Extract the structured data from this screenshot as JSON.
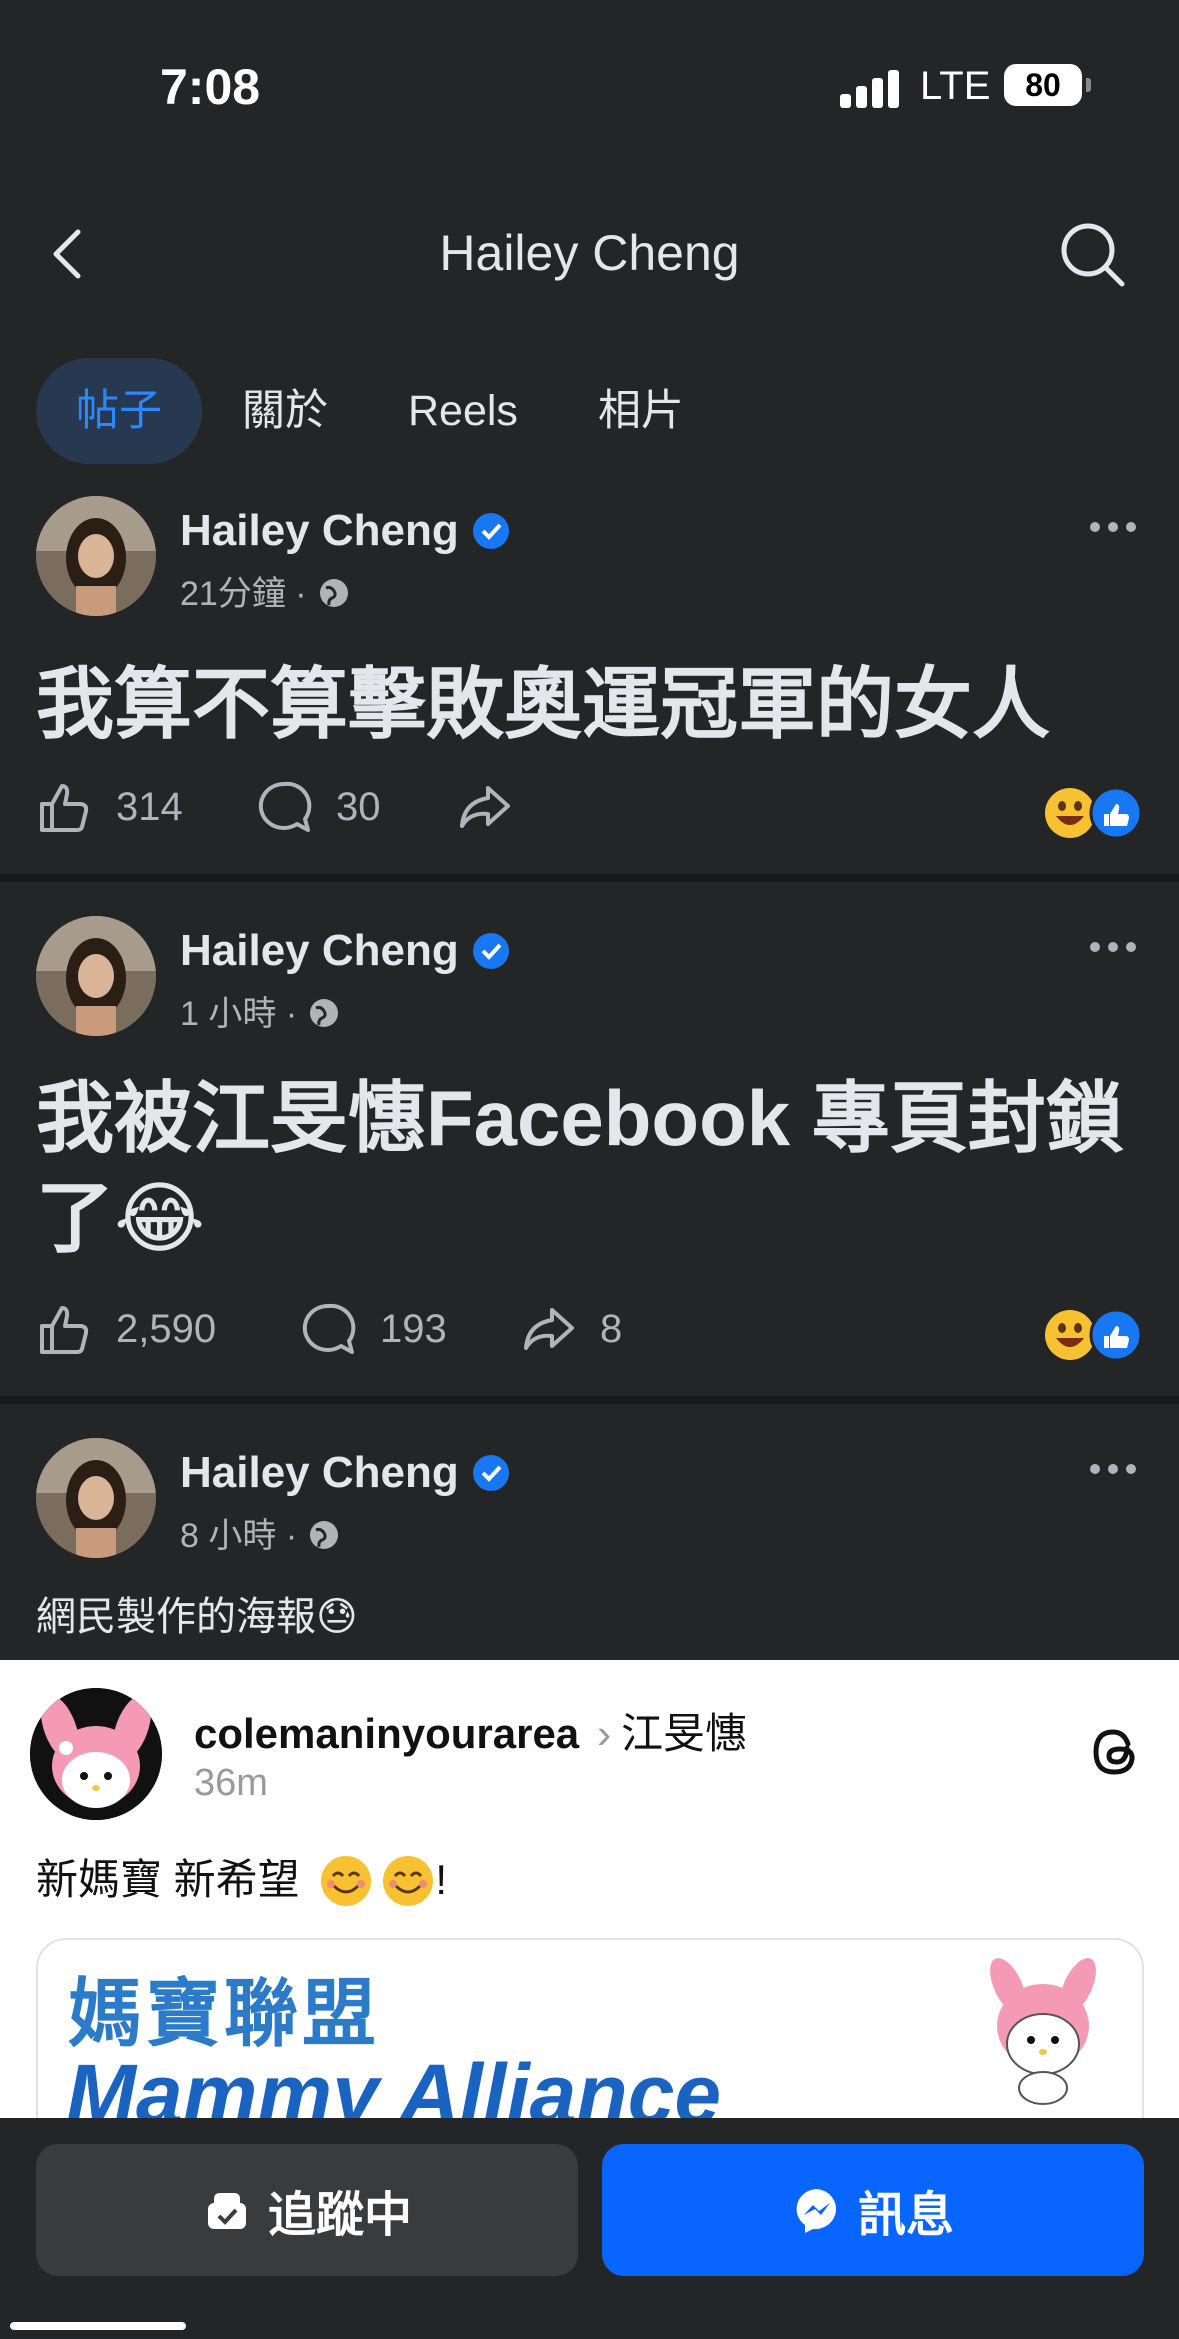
{
  "status_bar": {
    "time": "7:08",
    "network": "LTE",
    "battery": "80"
  },
  "header": {
    "title": "Hailey Cheng",
    "back_icon": "chevron-left-icon",
    "search_icon": "search-icon"
  },
  "tabs": [
    {
      "label": "帖子",
      "active": true
    },
    {
      "label": "關於",
      "active": false
    },
    {
      "label": "Reels",
      "active": false
    },
    {
      "label": "相片",
      "active": false
    }
  ],
  "posts": [
    {
      "author": "Hailey Cheng",
      "time": "21分鐘",
      "separator": "·",
      "text": "我算不算擊敗奧運冠軍的女人",
      "likes": "314",
      "comments": "30",
      "shares": ""
    },
    {
      "author": "Hailey Cheng",
      "time": "1 小時",
      "separator": "·",
      "text": "我被江旻憓Facebook 專頁封鎖了",
      "emoji": "😂",
      "likes": "2,590",
      "comments": "193",
      "shares": "8"
    },
    {
      "author": "Hailey Cheng",
      "time": "8 小時",
      "separator": "·",
      "text": "網民製作的海報",
      "emoji": "😓"
    }
  ],
  "embed": {
    "username": "colemaninyourarea",
    "arrow": "›",
    "target": "江旻憓",
    "time": "36m",
    "text_a": "新媽寶 新希望",
    "text_b": "!",
    "poster_cn": "媽寶聯盟",
    "poster_en": "Mammy Alliance"
  },
  "bottom": {
    "follow_label": "追蹤中",
    "message_label": "訊息"
  },
  "colors": {
    "background": "#242526",
    "accent": "#2d88ff",
    "message_button": "#0866ff",
    "verified": "#1877f2"
  }
}
